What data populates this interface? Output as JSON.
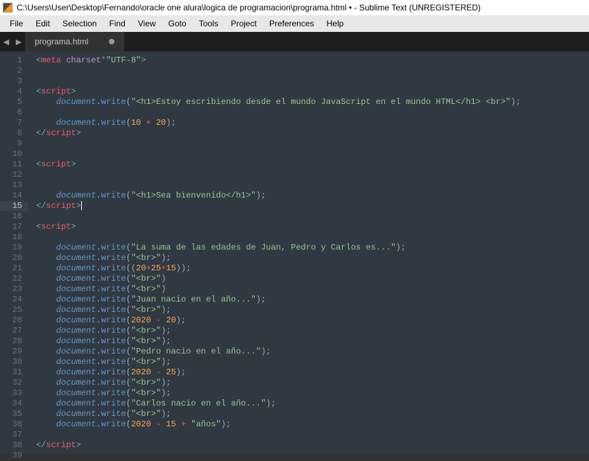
{
  "window": {
    "title": "C:\\Users\\User\\Desktop\\Fernando\\oracle one alura\\logica de programacion\\programa.html • - Sublime Text (UNREGISTERED)"
  },
  "menu": {
    "items": [
      "File",
      "Edit",
      "Selection",
      "Find",
      "View",
      "Goto",
      "Tools",
      "Project",
      "Preferences",
      "Help"
    ]
  },
  "tab": {
    "name": "programa.html"
  },
  "code": {
    "total_lines": 39,
    "current_line": 15,
    "lines": {
      "l1a": "meta",
      "l1b": "charset",
      "l1c": "\"UTF-8\"",
      "l4": "script",
      "l5o": "document",
      "l5m": "write",
      "l5s": "\"<h1>Estoy escribiendo desde el mundo JavaScript en el mundo HTML</h1> <br>\"",
      "l7o": "document",
      "l7m": "write",
      "l7n1": "10",
      "l7n2": "20",
      "l8": "script",
      "l11": "script",
      "l14o": "document",
      "l14m": "write",
      "l14s": "\"<h1>Sea bienvenido</h1>\"",
      "l15": "script",
      "l17": "script",
      "l19o": "document",
      "l19m": "write",
      "l19s": "\"La suma de las edades de Juan, Pedro y Carlos es...\"",
      "l20o": "document",
      "l20m": "write",
      "l20s": "\"<br>\"",
      "l21o": "document",
      "l21m": "write",
      "l21n1": "20",
      "l21n2": "25",
      "l21n3": "15",
      "l22o": "document",
      "l22m": "write",
      "l22s": "\"<br>\"",
      "l23o": "document",
      "l23m": "write",
      "l23s": "\"<br>\"",
      "l24o": "document",
      "l24m": "write",
      "l24s": "\"Juan nacio en el año...\"",
      "l25o": "document",
      "l25m": "write",
      "l25s": "\"<br>\"",
      "l26o": "document",
      "l26m": "write",
      "l26n1": "2020",
      "l26n2": "20",
      "l27o": "document",
      "l27m": "write",
      "l27s": "\"<br>\"",
      "l28o": "document",
      "l28m": "write",
      "l28s": "\"<br>\"",
      "l29o": "document",
      "l29m": "write",
      "l29s": "\"Pedro nacio en el año...\"",
      "l30o": "document",
      "l30m": "write",
      "l30s": "\"<br>\"",
      "l31o": "document",
      "l31m": "write",
      "l31n1": "2020",
      "l31n2": "25",
      "l32o": "document",
      "l32m": "write",
      "l32s": "\"<br>\"",
      "l33o": "document",
      "l33m": "write",
      "l33s": "\"<br>\"",
      "l34o": "document",
      "l34m": "write",
      "l34s": "\"Carlos nacio en el año...\"",
      "l35o": "document",
      "l35m": "write",
      "l35s": "\"<br>\"",
      "l36o": "document",
      "l36m": "write",
      "l36n1": "2020",
      "l36n2": "15",
      "l36s": "\"años\"",
      "l38": "script"
    }
  }
}
